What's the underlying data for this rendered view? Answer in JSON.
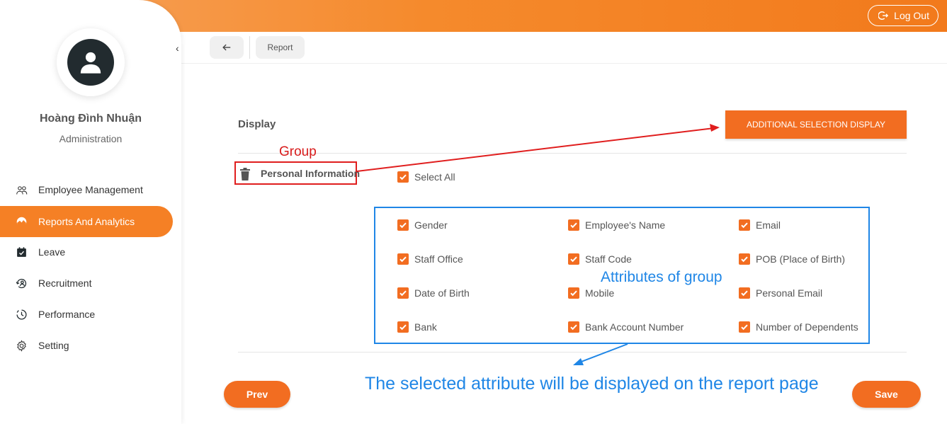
{
  "header": {
    "logout_label": "Log Out",
    "logout_icon": "logout-icon"
  },
  "user": {
    "name": "Hoàng Đình Nhuận",
    "role": "Administration",
    "avatar_icon": "user-icon"
  },
  "sidebar": {
    "collapse_icon": "chevron-left-icon",
    "items": [
      {
        "label": "Employee Management",
        "icon": "users-icon",
        "active": false
      },
      {
        "label": "Reports And Analytics",
        "icon": "pie-chart-icon",
        "active": true
      },
      {
        "label": "Leave",
        "icon": "calendar-check-icon",
        "active": false
      },
      {
        "label": "Recruitment",
        "icon": "recruitment-icon",
        "active": false
      },
      {
        "label": "Performance",
        "icon": "performance-icon",
        "active": false
      },
      {
        "label": "Setting",
        "icon": "gear-icon",
        "active": false
      }
    ]
  },
  "subheader": {
    "back_icon": "arrow-left-icon",
    "breadcrumb": "Report"
  },
  "main": {
    "section_title": "Display",
    "additional_button": "ADDITIONAL SELECTION DISPLAY",
    "group": {
      "name": "Personal Information",
      "delete_icon": "trash-icon"
    },
    "select_all": {
      "label": "Select All",
      "checked": true
    },
    "attributes": [
      {
        "label": "Gender",
        "checked": true
      },
      {
        "label": "Employee's Name",
        "checked": true
      },
      {
        "label": "Email",
        "checked": true
      },
      {
        "label": "Staff Office",
        "checked": true
      },
      {
        "label": "Staff Code",
        "checked": true
      },
      {
        "label": "POB (Place of Birth)",
        "checked": true
      },
      {
        "label": "Date of Birth",
        "checked": true
      },
      {
        "label": "Mobile",
        "checked": true
      },
      {
        "label": "Personal Email",
        "checked": true
      },
      {
        "label": "Bank",
        "checked": true
      },
      {
        "label": "Bank Account Number",
        "checked": true
      },
      {
        "label": "Number of Dependents",
        "checked": true
      }
    ],
    "prev_label": "Prev",
    "save_label": "Save"
  },
  "annotations": {
    "group": "Group",
    "attributes": "Attributes of group",
    "selected": "The selected attribute will be displayed on the report page"
  },
  "colors": {
    "accent": "#f26d21",
    "annotation_red": "#e01e1e",
    "annotation_blue": "#1f86e6"
  }
}
